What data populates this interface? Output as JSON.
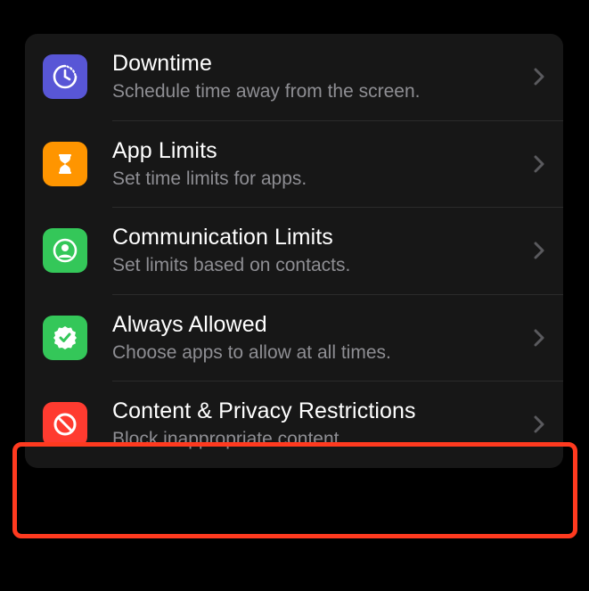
{
  "rows": [
    {
      "id": "downtime",
      "title": "Downtime",
      "subtitle": "Schedule time away from the screen.",
      "icon": "clock-icon",
      "iconClass": "icon-downtime"
    },
    {
      "id": "app-limits",
      "title": "App Limits",
      "subtitle": "Set time limits for apps.",
      "icon": "hourglass-icon",
      "iconClass": "icon-applimits"
    },
    {
      "id": "communication-limits",
      "title": "Communication Limits",
      "subtitle": "Set limits based on contacts.",
      "icon": "person-circle-icon",
      "iconClass": "icon-commlimits"
    },
    {
      "id": "always-allowed",
      "title": "Always Allowed",
      "subtitle": "Choose apps to allow at all times.",
      "icon": "checkmark-seal-icon",
      "iconClass": "icon-always"
    },
    {
      "id": "content-privacy",
      "title": "Content & Privacy Restrictions",
      "subtitle": "Block inappropriate content.",
      "icon": "nosign-icon",
      "iconClass": "icon-content"
    }
  ]
}
